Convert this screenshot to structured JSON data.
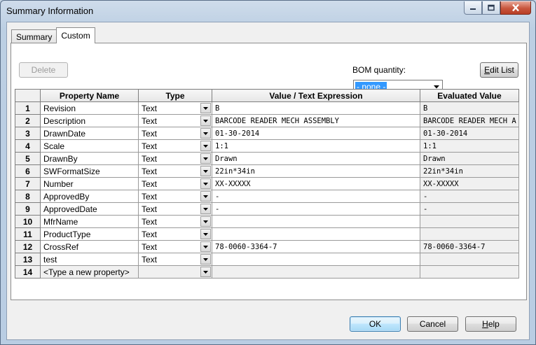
{
  "window": {
    "title": "Summary Information"
  },
  "tabs": [
    {
      "label": "Summary"
    },
    {
      "label": "Custom"
    }
  ],
  "toolbar": {
    "delete_label": "Delete",
    "bom_label": "BOM quantity:",
    "bom_value": "- none -",
    "edit_list_prefix": "",
    "edit_list_hot": "E",
    "edit_list_rest": "dit List"
  },
  "grid": {
    "headers": [
      "Property Name",
      "Type",
      "Value / Text Expression",
      "Evaluated Value"
    ],
    "rows": [
      {
        "num": "1",
        "name": "Revision",
        "type": "Text",
        "value": "B",
        "evaluated": "B"
      },
      {
        "num": "2",
        "name": "Description",
        "type": "Text",
        "value": "BARCODE READER MECH ASSEMBLY",
        "evaluated": "BARCODE READER MECH A"
      },
      {
        "num": "3",
        "name": "DrawnDate",
        "type": "Text",
        "value": "01-30-2014",
        "evaluated": "01-30-2014"
      },
      {
        "num": "4",
        "name": "Scale",
        "type": "Text",
        "value": "1:1",
        "evaluated": "1:1"
      },
      {
        "num": "5",
        "name": "DrawnBy",
        "type": "Text",
        "value": "Drawn",
        "evaluated": "Drawn"
      },
      {
        "num": "6",
        "name": "SWFormatSize",
        "type": "Text",
        "value": "22in*34in",
        "evaluated": "22in*34in"
      },
      {
        "num": "7",
        "name": "Number",
        "type": "Text",
        "value": "XX-XXXXX",
        "evaluated": "XX-XXXXX"
      },
      {
        "num": "8",
        "name": "ApprovedBy",
        "type": "Text",
        "value": "-",
        "evaluated": "-"
      },
      {
        "num": "9",
        "name": "ApprovedDate",
        "type": "Text",
        "value": "-",
        "evaluated": "-"
      },
      {
        "num": "10",
        "name": "MfrName",
        "type": "Text",
        "value": "",
        "evaluated": ""
      },
      {
        "num": "11",
        "name": "ProductType",
        "type": "Text",
        "value": "",
        "evaluated": ""
      },
      {
        "num": "12",
        "name": "CrossRef",
        "type": "Text",
        "value": "78-0060-3364-7",
        "evaluated": "78-0060-3364-7"
      },
      {
        "num": "13",
        "name": "test",
        "type": "Text",
        "value": "",
        "evaluated": ""
      },
      {
        "num": "14",
        "name": "<Type a new property>",
        "type": "",
        "value": "",
        "evaluated": ""
      }
    ]
  },
  "footer": {
    "ok_label": "OK",
    "cancel_label": "Cancel",
    "help_hot": "H",
    "help_rest": "elp"
  },
  "colors": {
    "selection": "#3399ff",
    "close_button": "#c8563d",
    "default_button_border": "#3c7fb1"
  }
}
